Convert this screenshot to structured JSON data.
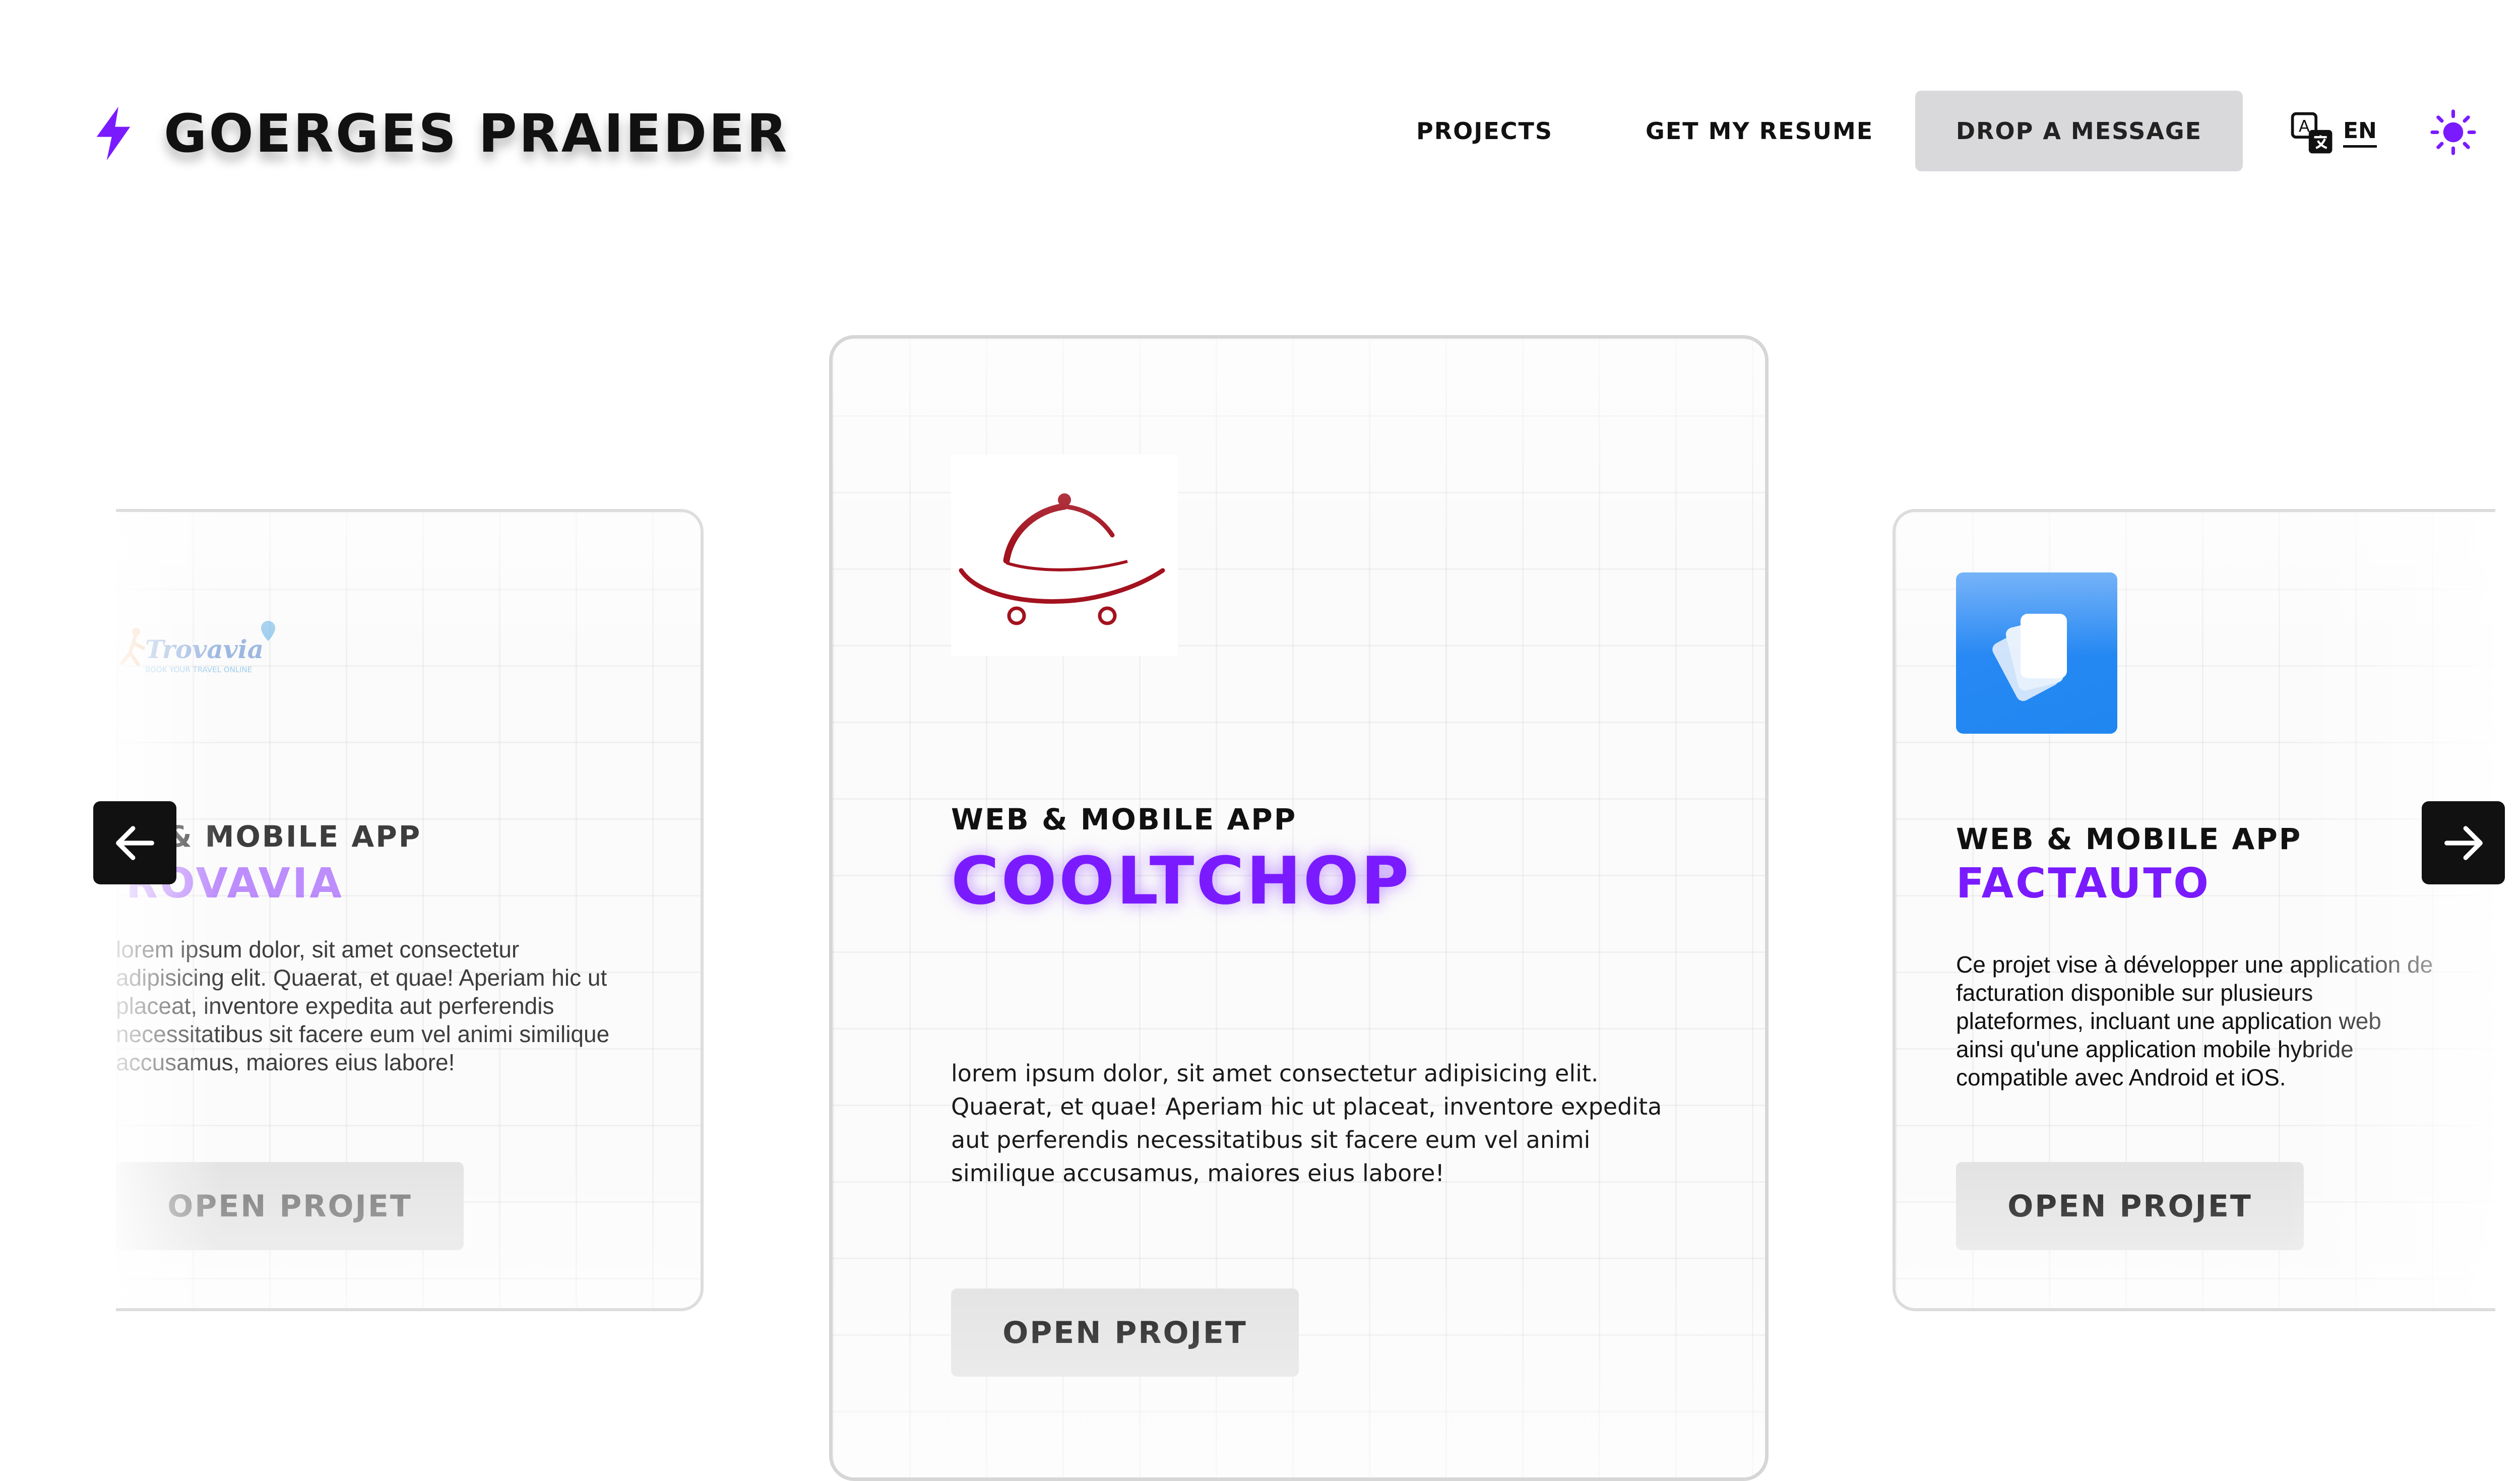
{
  "header": {
    "brand_name": "Goerges Praieder",
    "nav_projects": "Projects",
    "nav_resume": "Get my resume",
    "nav_message": "Drop a message",
    "language_label": "EN",
    "accent_color": "#7a1bff"
  },
  "carousel": {
    "prev_icon": "arrow-left-icon",
    "next_icon": "arrow-right-icon",
    "cards": [
      {
        "logo_text": "Trovavia",
        "logo_tagline": "BOOK YOUR TRAVEL ONLINE",
        "subtitle": "Web & mobile app",
        "title": "Trovavia",
        "description": "lorem ipsum dolor, sit amet consectetur adipisicing elit. Quaerat, et quae! Aperiam hic ut placeat, inventore expedita aut perferendis necessitatibus sit facere eum vel animi similique accusamus, maiores eius labore!",
        "button_label": "Open projet"
      },
      {
        "logo_icon": "food-cart-icon",
        "subtitle": "Web & mobile app",
        "title": "CoolTchop",
        "description": "lorem ipsum dolor, sit amet consectetur adipisicing elit. Quaerat, et quae! Aperiam hic ut placeat, inventore expedita aut perferendis necessitatibus sit facere eum vel animi similique accusamus, maiores eius labore!",
        "button_label": "Open projet"
      },
      {
        "logo_icon": "cards-app-icon",
        "subtitle": "Web & mobile app",
        "title": "FactAuto",
        "description": "Ce projet vise à développer une application de facturation disponible sur plusieurs plateformes, incluant une application web ainsi qu'une application mobile hybride compatible avec Android et iOS.",
        "button_label": "Open projet"
      }
    ]
  }
}
